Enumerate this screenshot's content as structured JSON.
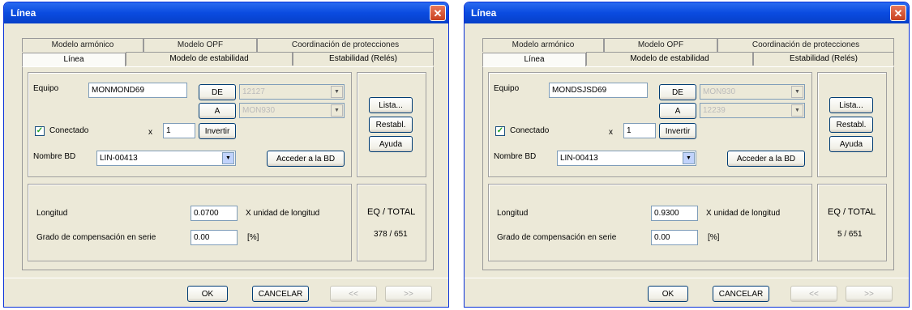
{
  "windows": [
    {
      "title": "Línea",
      "tabs_back": [
        "Modelo armónico",
        "Modelo OPF",
        "Coordinación de protecciones"
      ],
      "tabs_front": [
        "Línea",
        "Modelo de estabilidad",
        "Estabilidad (Relés)"
      ],
      "equipo_label": "Equipo",
      "equipo_value": "MONMOND69",
      "de_label": "DE",
      "a_label": "A",
      "de_value": "12127",
      "a_value": "MON930",
      "conectado_label": "Conectado",
      "x_label": "x",
      "x_value": "1",
      "invertir_label": "Invertir",
      "nombre_bd_label": "Nombre BD",
      "nombre_bd_value": "LIN-00413",
      "acceder_label": "Acceder a la BD",
      "lista_label": "Lista...",
      "restabl_label": "Restabl.",
      "ayuda_label": "Ayuda",
      "longitud_label": "Longitud",
      "longitud_value": "0.0700",
      "longitud_unit": "X unidad de longitud",
      "grado_label": "Grado de compensación en serie",
      "grado_value": "0.00",
      "grado_unit": "[%]",
      "eq_total_label": "EQ / TOTAL",
      "eq_total_value": "378 / 651",
      "ok_label": "OK",
      "cancelar_label": "CANCELAR",
      "prev_label": "<<",
      "next_label": ">>"
    },
    {
      "title": "Línea",
      "tabs_back": [
        "Modelo armónico",
        "Modelo OPF",
        "Coordinación de protecciones"
      ],
      "tabs_front": [
        "Línea",
        "Modelo de estabilidad",
        "Estabilidad (Relés)"
      ],
      "equipo_label": "Equipo",
      "equipo_value": "MONDSJSD69",
      "de_label": "DE",
      "a_label": "A",
      "de_value": "MON930",
      "a_value": "12239",
      "conectado_label": "Conectado",
      "x_label": "x",
      "x_value": "1",
      "invertir_label": "Invertir",
      "nombre_bd_label": "Nombre BD",
      "nombre_bd_value": "LIN-00413",
      "acceder_label": "Acceder a la BD",
      "lista_label": "Lista...",
      "restabl_label": "Restabl.",
      "ayuda_label": "Ayuda",
      "longitud_label": "Longitud",
      "longitud_value": "0.9300",
      "longitud_unit": "X unidad de longitud",
      "grado_label": "Grado de compensación en serie",
      "grado_value": "0.00",
      "grado_unit": "[%]",
      "eq_total_label": "EQ / TOTAL",
      "eq_total_value": "5 / 651",
      "ok_label": "OK",
      "cancelar_label": "CANCELAR",
      "prev_label": "<<",
      "next_label": ">>"
    }
  ],
  "icons": {
    "close": "close-icon",
    "dropdown": "chevron-down-icon",
    "checkbox": "checkmark-icon"
  }
}
